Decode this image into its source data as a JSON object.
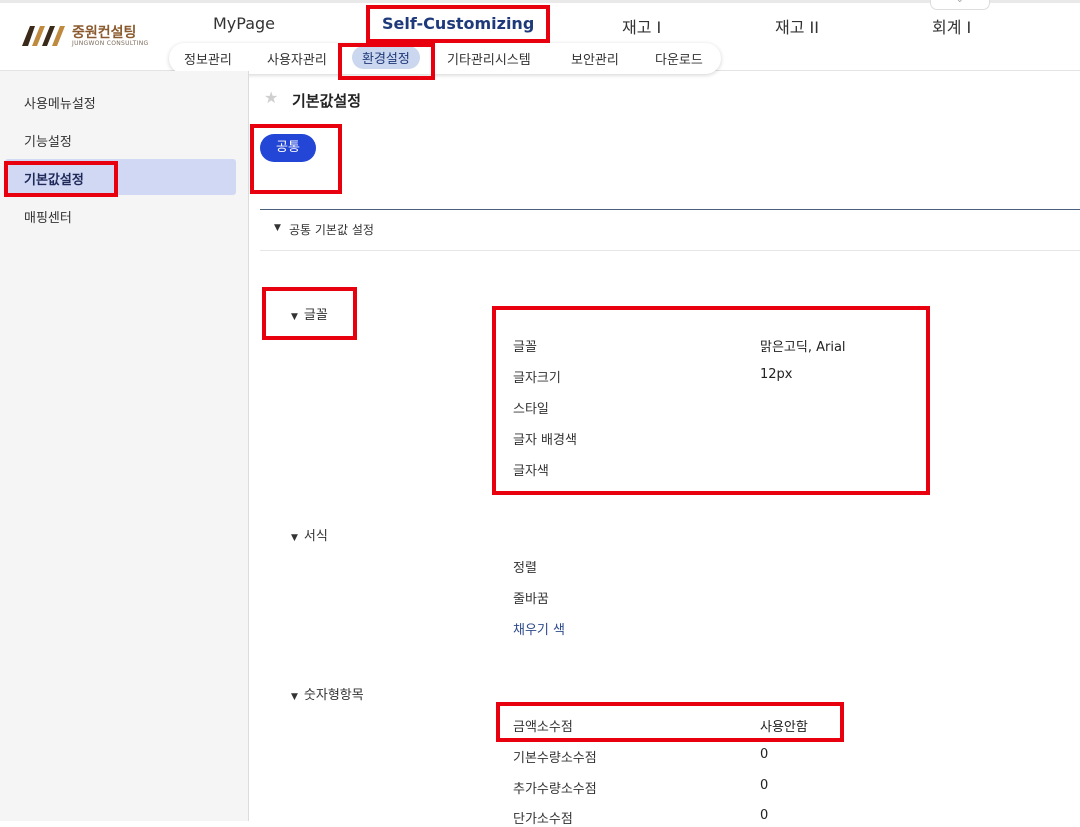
{
  "header": {
    "logo": {
      "name_kr": "중원컨설팅",
      "name_en": "JUNGWON CONSULTING"
    },
    "main_menu": [
      {
        "label": "MyPage"
      },
      {
        "label": "Self-Customizing"
      },
      {
        "label": "재고 I"
      },
      {
        "label": "재고 II"
      },
      {
        "label": "회계 I"
      }
    ],
    "sub_menu": [
      {
        "label": "정보관리"
      },
      {
        "label": "사용자관리"
      },
      {
        "label": "환경설정"
      },
      {
        "label": "기타관리시스템"
      },
      {
        "label": "보안관리"
      },
      {
        "label": "다운로드"
      }
    ],
    "collapse_icon": "chevron-down-icon"
  },
  "sidebar": {
    "items": [
      {
        "label": "사용메뉴설정"
      },
      {
        "label": "기능설정"
      },
      {
        "label": "기본값설정"
      },
      {
        "label": "매핑센터"
      }
    ]
  },
  "content": {
    "favorite_icon": "star-icon",
    "title": "기본값설정",
    "tab_common": "공통",
    "section_title": "공통 기본값 설정",
    "groups": {
      "font": {
        "title": "글꼴",
        "rows": [
          {
            "label": "글꼴",
            "value": "맑은고딕, Arial"
          },
          {
            "label": "글자크기",
            "value": "12px"
          },
          {
            "label": "스타일",
            "value": ""
          },
          {
            "label": "글자 배경색",
            "value": ""
          },
          {
            "label": "글자색",
            "value": ""
          }
        ]
      },
      "format": {
        "title": "서식",
        "rows": [
          {
            "label": "정렬"
          },
          {
            "label": "줄바꿈"
          },
          {
            "label": "채우기 색"
          }
        ]
      },
      "numeric": {
        "title": "숫자형항목",
        "rows": [
          {
            "label": "금액소수점",
            "value": "사용안함"
          },
          {
            "label": "기본수량소수점",
            "value": "0"
          },
          {
            "label": "추가수량소수점",
            "value": "0"
          },
          {
            "label": "단가소수점",
            "value": "0"
          }
        ]
      }
    }
  },
  "colors": {
    "accent": "#2346d6",
    "highlight": "#e8000f",
    "sidebar_active": "#d0d8f3"
  }
}
